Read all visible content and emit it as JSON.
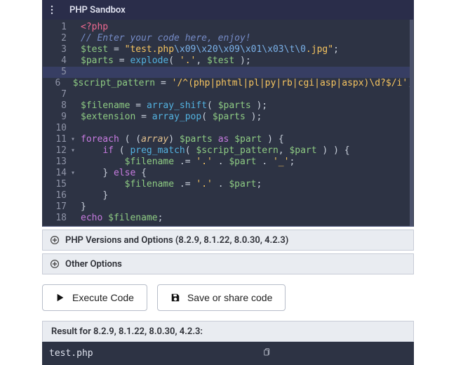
{
  "header": {
    "title": "PHP Sandbox"
  },
  "code": {
    "lines": [
      {
        "n": 1,
        "fold": "",
        "html": "<span class='tag'>&lt;?php</span>"
      },
      {
        "n": 2,
        "fold": "",
        "html": "<span class='cm'>// Enter your code here, enjoy!</span>"
      },
      {
        "n": 3,
        "fold": "",
        "html": "<span class='var'>$test</span> <span class='pun'>=</span> <span class='str'>\"test.php</span><span class='esc'>\\x09\\x20\\x09\\x01\\x03\\t\\0</span><span class='str'>.jpg\"</span><span class='pun'>;</span>"
      },
      {
        "n": 4,
        "fold": "",
        "html": "<span class='var'>$parts</span> <span class='pun'>=</span> <span class='fn'>explode</span><span class='pun'>(</span> <span class='str'>'.'</span><span class='pun'>,</span> <span class='var'>$test</span> <span class='pun'>);</span>"
      },
      {
        "n": 5,
        "fold": "",
        "html": "",
        "active": true
      },
      {
        "n": 6,
        "fold": "",
        "html": "<span class='var'>$script_pattern</span> <span class='pun'>=</span> <span class='str'>'/^(php|phtml|pl|py|rb|cgi|asp|aspx)\\d?$/i'</span><span class='pun'>;</span>"
      },
      {
        "n": 7,
        "fold": "",
        "html": ""
      },
      {
        "n": 8,
        "fold": "",
        "html": "<span class='var'>$filename</span> <span class='pun'>=</span> <span class='fn'>array_shift</span><span class='pun'>(</span> <span class='var'>$parts</span> <span class='pun'>);</span>"
      },
      {
        "n": 9,
        "fold": "",
        "html": "<span class='var'>$extension</span> <span class='pun'>=</span> <span class='fn'>array_pop</span><span class='pun'>(</span> <span class='var'>$parts</span> <span class='pun'>);</span>"
      },
      {
        "n": 10,
        "fold": "",
        "html": ""
      },
      {
        "n": 11,
        "fold": "▾",
        "html": "<span class='kw'>foreach</span> <span class='pun'>(</span> <span class='pun'>(</span><span class='cast'>array</span><span class='pun'>)</span> <span class='var'>$parts</span> <span class='kw'>as</span> <span class='var'>$part</span> <span class='pun'>)</span> <span class='pun'>{</span>"
      },
      {
        "n": 12,
        "fold": "▾",
        "html": "    <span class='kw'>if</span> <span class='pun'>(</span> <span class='fn'>preg_match</span><span class='pun'>(</span> <span class='var'>$script_pattern</span><span class='pun'>,</span> <span class='var'>$part</span> <span class='pun'>)</span> <span class='pun'>)</span> <span class='pun'>{</span>"
      },
      {
        "n": 13,
        "fold": "",
        "html": "        <span class='var'>$filename</span> <span class='pun'>.=</span> <span class='str'>'.'</span> <span class='pun'>.</span> <span class='var'>$part</span> <span class='pun'>.</span> <span class='str'>'_'</span><span class='pun'>;</span>"
      },
      {
        "n": 14,
        "fold": "▾",
        "html": "    <span class='pun'>}</span> <span class='kw'>else</span> <span class='pun'>{</span>"
      },
      {
        "n": 15,
        "fold": "",
        "html": "        <span class='var'>$filename</span> <span class='pun'>.=</span> <span class='str'>'.'</span> <span class='pun'>.</span> <span class='var'>$part</span><span class='pun'>;</span>"
      },
      {
        "n": 16,
        "fold": "",
        "html": "    <span class='pun'>}</span>"
      },
      {
        "n": 17,
        "fold": "",
        "html": "<span class='pun'>}</span>"
      },
      {
        "n": 18,
        "fold": "",
        "html": "<span class='kw'>echo</span> <span class='var'>$filename</span><span class='pun'>;</span>"
      }
    ]
  },
  "accordions": {
    "versions": "PHP Versions and Options (8.2.9, 8.1.22, 8.0.30, 4.2.3)",
    "other": "Other Options"
  },
  "buttons": {
    "execute": "Execute Code",
    "save": "Save or share code"
  },
  "result": {
    "heading": "Result for 8.2.9, 8.1.22, 8.0.30, 4.2.3:",
    "output": "test.php"
  }
}
